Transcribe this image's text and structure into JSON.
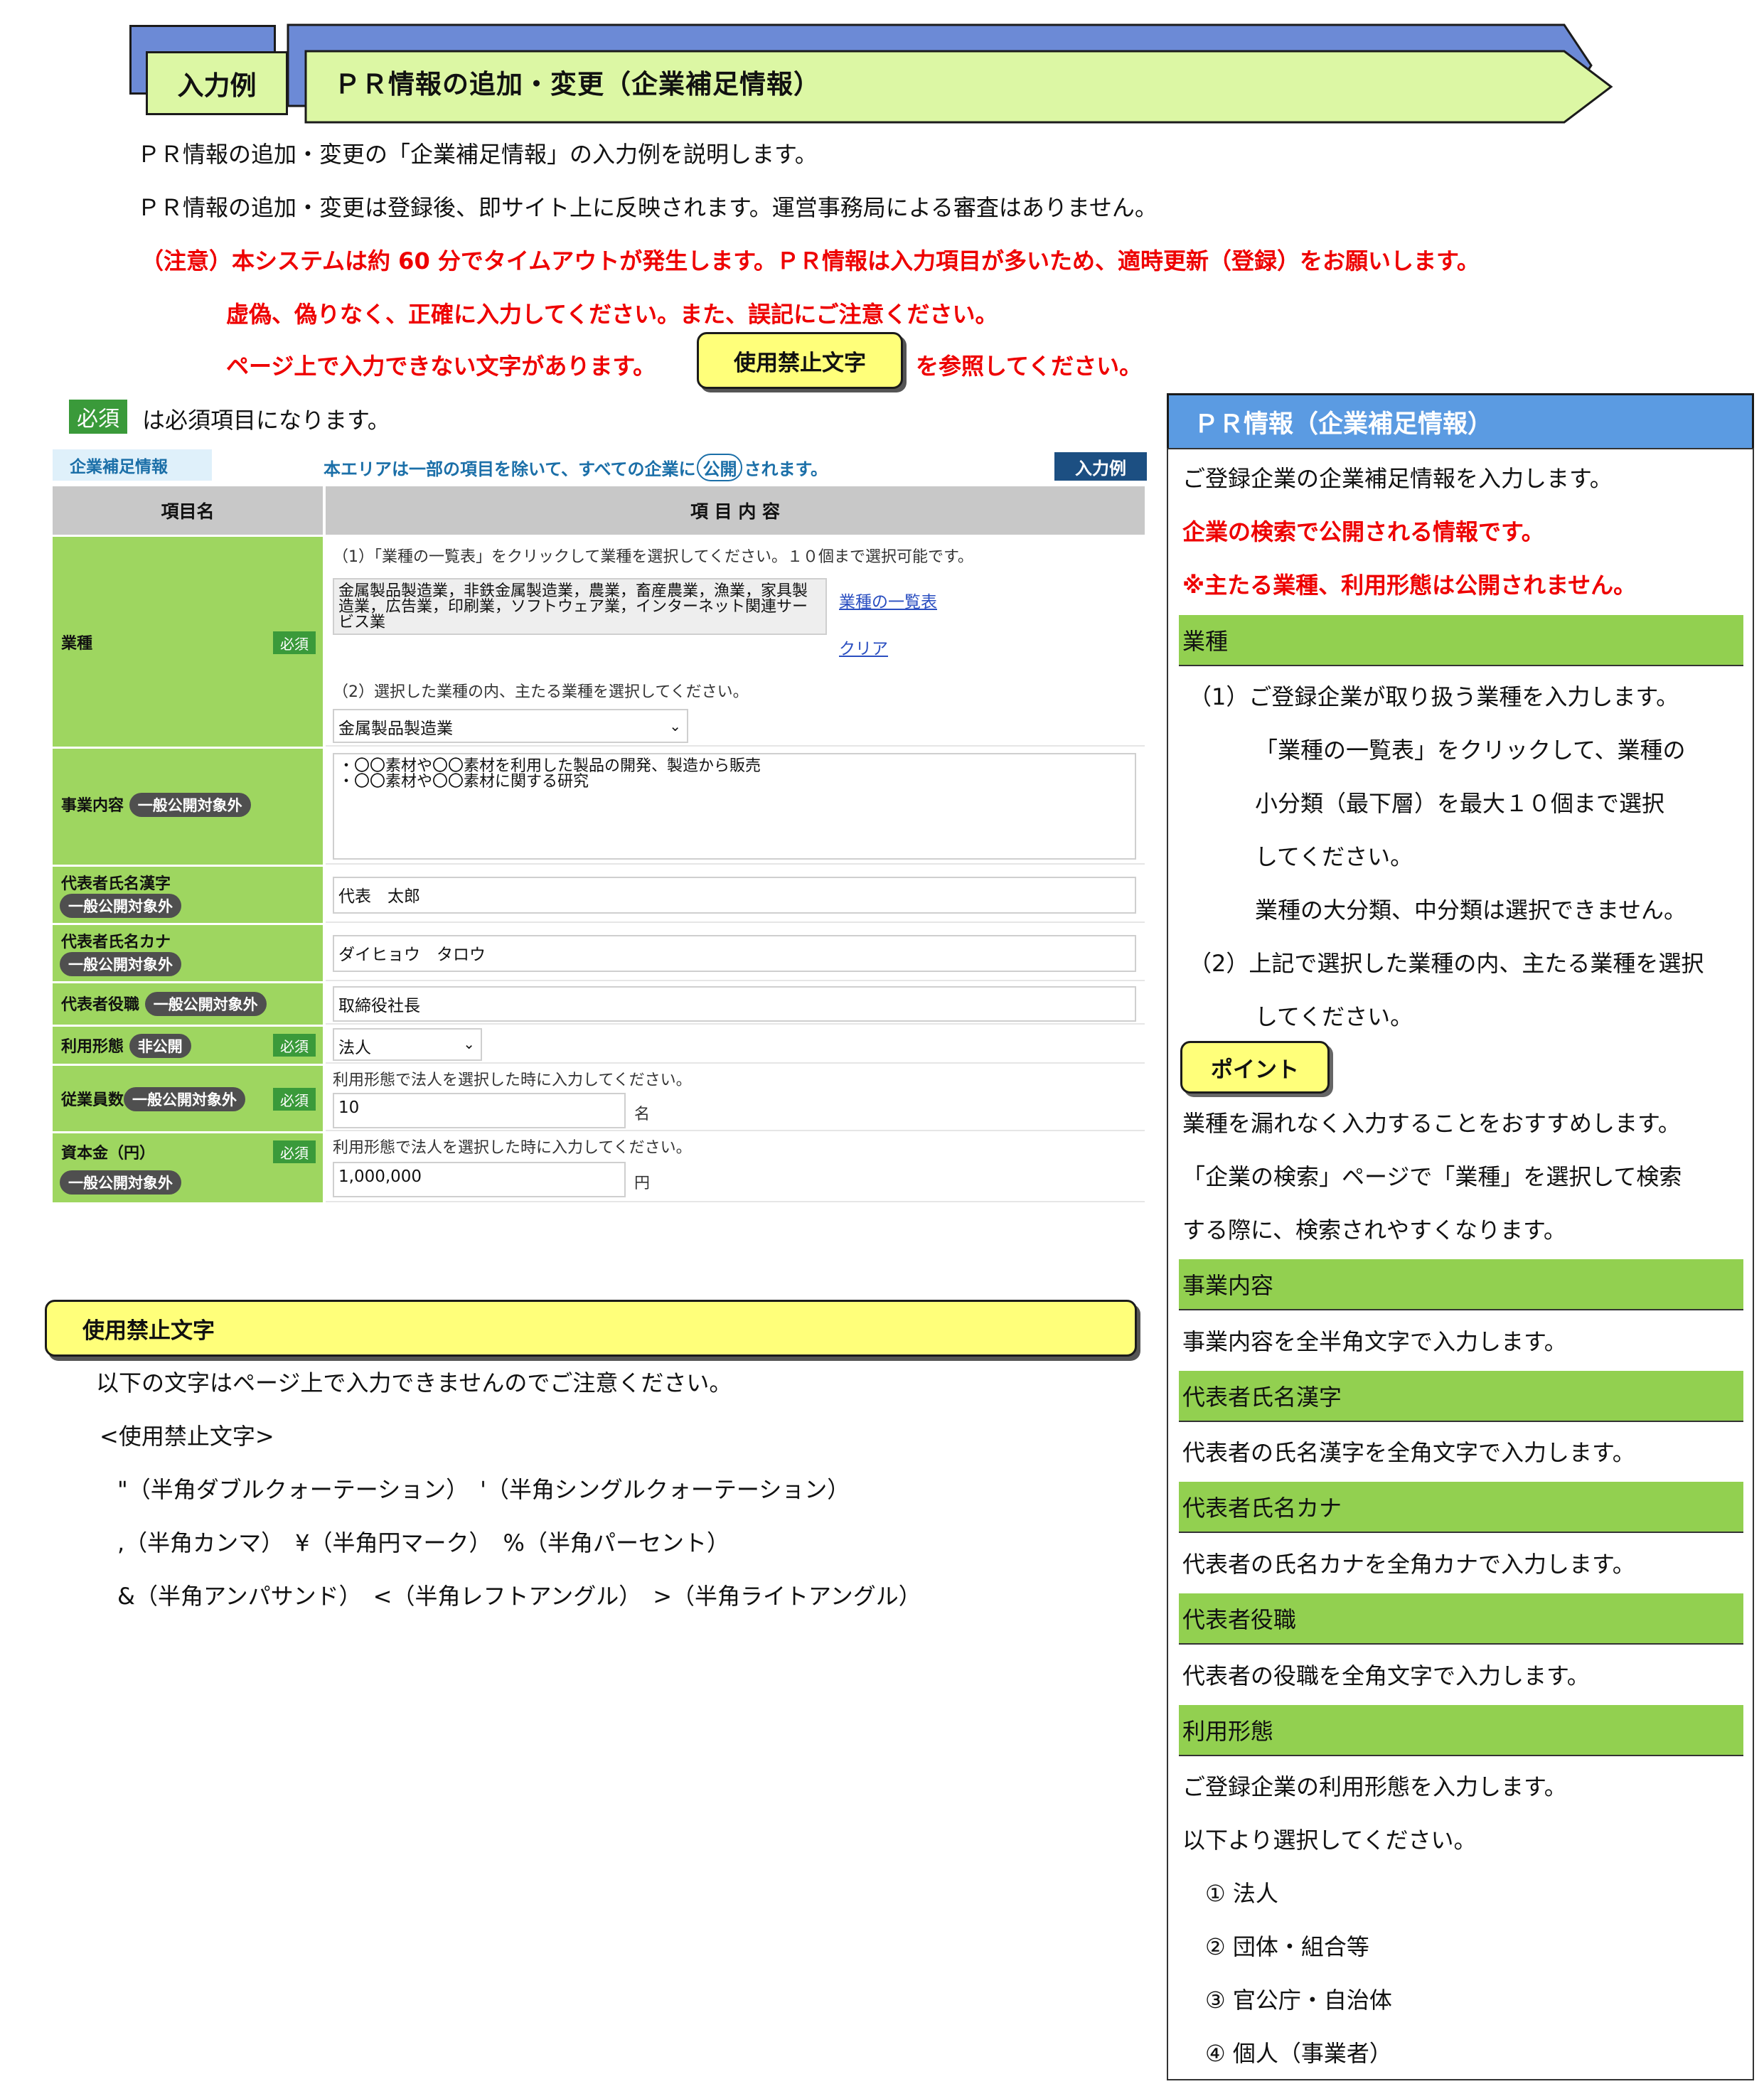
{
  "header": {
    "tag": "入力例",
    "title": "ＰＲ情報の追加・変更（企業補足情報）"
  },
  "intro": {
    "line1": "ＰＲ情報の追加・変更の「企業補足情報」の入力例を説明します。",
    "line2": "ＰＲ情報の追加・変更は登録後、即サイト上に反映されます。運営事務局による審査はありません。",
    "note1": "（注意）本システムは約 60 分でタイムアウトが発生します。ＰＲ情報は入力項目が多いため、適時更新（登録）をお願いします。",
    "note2": "虚偽、偽りなく、正確に入力してください。また、誤記にご注意ください。",
    "note3_pre": "ページ上で入力できない文字があります。",
    "note3_button": "使用禁止文字",
    "note3_post": "を参照してください。",
    "required_badge": "必須",
    "required_text": "は必須項目になります。"
  },
  "form": {
    "section_label": "企業補足情報",
    "notice_pre": "本エリアは一部の項目を除いて、すべての企業に",
    "notice_circle": "公開",
    "notice_post": "されます。",
    "example_badge": "入力例",
    "col_item": "項目名",
    "col_content": "項 目 内 容",
    "hissu": "必須",
    "pill_general": "一般公開対象外",
    "pill_private": "非公開",
    "industry": {
      "label": "業種",
      "instr1": "（1）「業種の一覧表」をクリックして業種を選択してください。１０個まで選択可能です。",
      "selected": "金属製品製造業，非鉄金属製造業，農業，畜産農業，漁業，家具製造業，広告業，印刷業，ソフトウェア業，インターネット関連サービス業",
      "list_link": "業種の一覧表",
      "clear_link": "クリア",
      "instr2": "（2）選択した業種の内、主たる業種を選択してください。",
      "main_value": "金属製品製造業"
    },
    "business": {
      "label": "事業内容",
      "line1": "・〇〇素材や〇〇素材を利用した製品の開発、製造から販売",
      "line2": "・〇〇素材や〇〇素材に関する研究"
    },
    "rep_kanji": {
      "label": "代表者氏名漢字",
      "value": "代表　太郎"
    },
    "rep_kana": {
      "label": "代表者氏名カナ",
      "value": "ダイヒョウ　タロウ"
    },
    "rep_title": {
      "label": "代表者役職",
      "value": "取締役社長"
    },
    "usage": {
      "label": "利用形態",
      "value": "法人"
    },
    "employees": {
      "label": "従業員数",
      "hint": "利用形態で法人を選択した時に入力してください。",
      "value": "10",
      "unit": "名"
    },
    "capital": {
      "label": "資本金（円）",
      "hint": "利用形態で法人を選択した時に入力してください。",
      "value": "1,000,000",
      "unit": "円"
    }
  },
  "banned": {
    "title": "使用禁止文字",
    "intro": "以下の文字はページ上で入力できませんのでご注意ください。",
    "list_title": "<使用禁止文字>",
    "row1": "\"（半角ダブルクォーテーション）　'（半角シングルクォーテーション）",
    "row2": ",（半角カンマ）　¥（半角円マーク）　%（半角パーセント）",
    "row3": "&（半角アンパサンド）　<（半角レフトアングル）　>（半角ライトアングル）"
  },
  "side": {
    "title": "ＰＲ情報（企業補足情報）",
    "intro": "ご登録企業の企業補足情報を入力します。",
    "red1": "企業の検索で公開される情報です。",
    "red2": "※主たる業種、利用形態は公開されません。",
    "h_industry": "業種",
    "ind1": "（1）ご登録企業が取り扱う業種を入力します。",
    "ind2": "「業種の一覧表」をクリックして、業種の",
    "ind3": "小分類（最下層）を最大１０個まで選択",
    "ind4": "してください。",
    "ind5": "業種の大分類、中分類は選択できません。",
    "ind6": "（2）上記で選択した業種の内、主たる業種を選択",
    "ind7": "してください。",
    "point": "ポイント",
    "pt1": "業種を漏れなく入力することをおすすめします。",
    "pt2": "「企業の検索」ページで「業種」を選択して検索",
    "pt3": "する際に、検索されやすくなります。",
    "h_business": "事業内容",
    "business": "事業内容を全半角文字で入力します。",
    "h_kanji": "代表者氏名漢字",
    "kanji": "代表者の氏名漢字を全角文字で入力します。",
    "h_kana": "代表者氏名カナ",
    "kana": "代表者の氏名カナを全角カナで入力します。",
    "h_title": "代表者役職",
    "title_desc": "代表者の役職を全角文字で入力します。",
    "h_usage": "利用形態",
    "usage1": "ご登録企業の利用形態を入力します。",
    "usage2": "以下より選択してください。",
    "opt1": "① 法人",
    "opt2": "② 団体・組合等",
    "opt3": "③ 官公庁・自治体",
    "opt4": "④ 個人（事業者）"
  }
}
